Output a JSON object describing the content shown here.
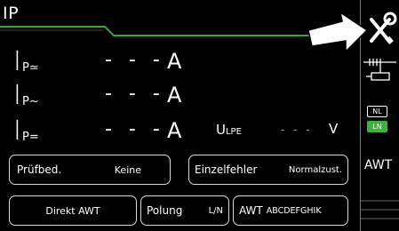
{
  "header": {
    "title": "IP"
  },
  "measurements": [
    {
      "symbol": "I",
      "subscript": "P≃",
      "value": "- - -",
      "unit": "A"
    },
    {
      "symbol": "I",
      "subscript": "P~",
      "value": "- - -",
      "unit": "A"
    },
    {
      "symbol": "I",
      "subscript": "P=",
      "value": "- - -",
      "unit": "A"
    }
  ],
  "voltage": {
    "symbol": "U",
    "subscript": "LPE",
    "value": "- - -",
    "unit": "V"
  },
  "buttons": {
    "pruefbed_label": "Prüfbed.",
    "pruefbed_value": "Keine",
    "einzelfehler_label": "Einzelfehler",
    "einzelfehler_value": "Normalzust.",
    "direkt_awt_label": "Direkt AWT",
    "polung_label": "Polung",
    "polung_value": "L/N",
    "awt_label": "AWT",
    "awt_value": "ABCDEFGHIK"
  },
  "sidebar": {
    "settings_icon": "tools-icon",
    "pointer_icon": "arrow-pointer-icon",
    "probe_icon": "probe-icon",
    "nl_label": "NL",
    "ln_label": "LN",
    "awt_label": "AWT"
  },
  "colors": {
    "accent_green": "#3aa635",
    "ln_green": "#3cb43c",
    "background": "#000000"
  }
}
